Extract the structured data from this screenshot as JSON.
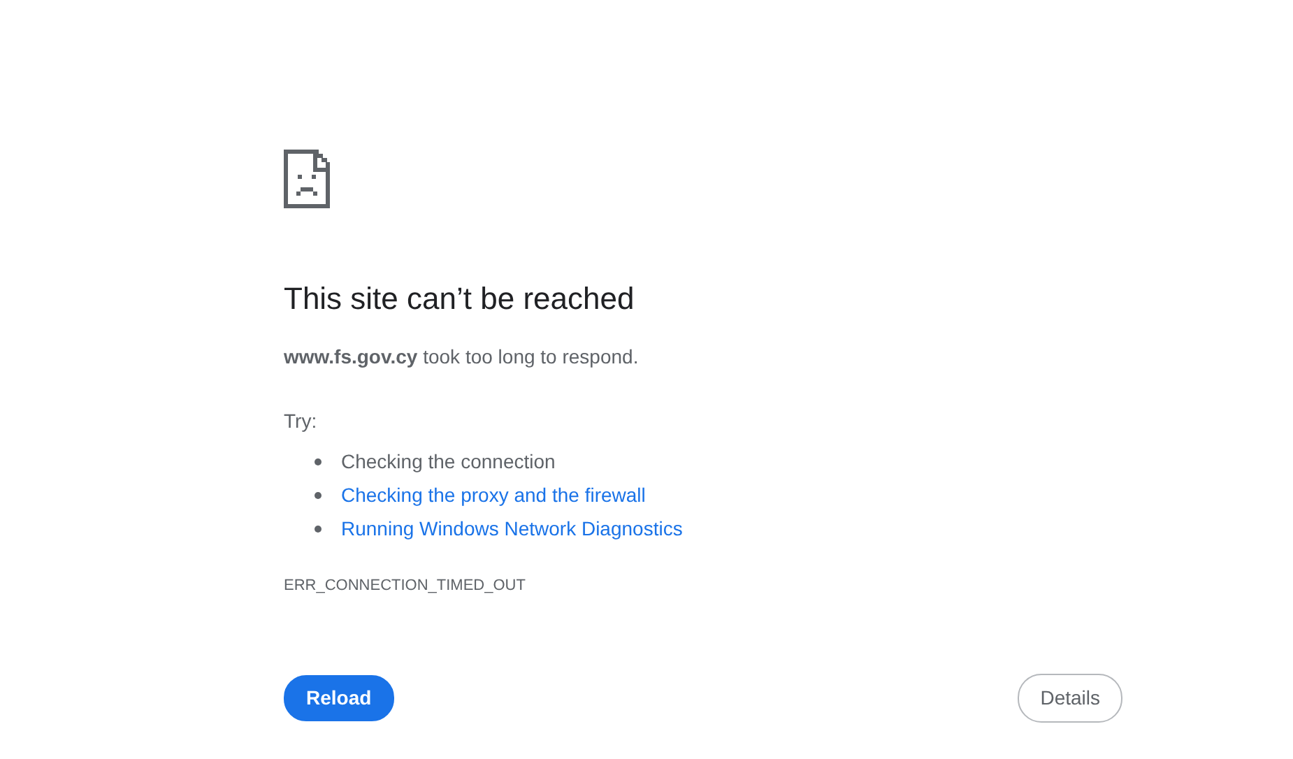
{
  "heading": "This site can’t be reached",
  "message": "**www.fs.gov.cy** took too long to respond.",
  "try_label": "Try:",
  "suggestions": [
    {
      "kind": "text",
      "label": "Checking the connection"
    },
    {
      "kind": "link",
      "label": "Checking the proxy and the firewall"
    },
    {
      "kind": "link",
      "label": "Running Windows Network Diagnostics"
    }
  ],
  "error_code": "ERR_CONNECTION_TIMED_OUT",
  "buttons": [
    {
      "kind": "primary",
      "label": "Reload"
    },
    {
      "kind": "secondary",
      "label": "Details"
    }
  ]
}
